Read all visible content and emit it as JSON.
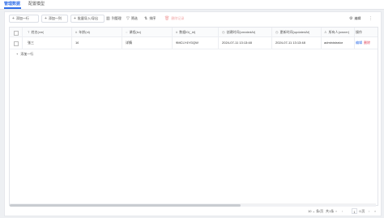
{
  "tabs": [
    {
      "label": "管理数据"
    },
    {
      "label": "配置模型"
    }
  ],
  "toolbar": {
    "add_row": "添加一行",
    "add_column": "添加一列",
    "import": "批量导入/导出",
    "field_manage": "列管理",
    "filter": "筛选",
    "sort": "排序",
    "delete_selected": "删除记录",
    "right_label": "编辑"
  },
  "table": {
    "columns": [
      "姓名(xm)",
      "年龄(nl)",
      "课程(kc)",
      "数据ID(_id)",
      "创建时间(createdAt)",
      "更新时间(updatedAt)",
      "所有人(owner)",
      "操作"
    ],
    "rows": [
      {
        "xm": "张三",
        "nl": "16",
        "kc": "详情",
        "id": "9MCLY4YGQW",
        "createdAt": "2024-07-11 13:13:48",
        "updatedAt": "2024-07-11 13:13:48",
        "owner": "administrator",
        "edit": "编辑",
        "delete": "删除"
      }
    ],
    "add_row_label": "添加一行"
  },
  "pagination": {
    "page_size": "10",
    "page_size_unit": "条/页",
    "total": "共1条",
    "current_page": "1",
    "total_pages": "/1页"
  },
  "scrollbar": {
    "position": 0.63
  }
}
